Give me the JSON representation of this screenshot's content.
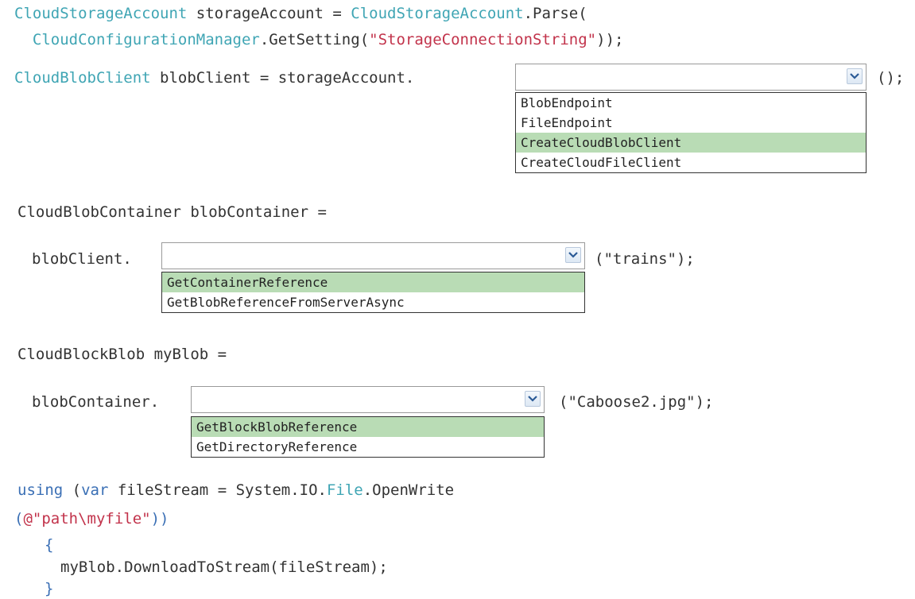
{
  "code": {
    "l1": {
      "t1": "CloudStorageAccount",
      "t2": " storageAccount = ",
      "t3": "CloudStorageAccount",
      "t4": ".Parse("
    },
    "l2": {
      "t1": "  CloudConfigurationManager",
      "t2": ".GetSetting(",
      "t3": "\"StorageConnectionString\"",
      "t4": "));"
    },
    "l3": {
      "t1": "CloudBlobClient",
      "t2": " blobClient = storageAccount.",
      "suffix": "();"
    },
    "l4": {
      "text": "CloudBlobContainer blobContainer ="
    },
    "l5": {
      "prefix": "blobClient.",
      "suffix": "(\"trains\");"
    },
    "l6": {
      "text": "CloudBlockBlob myBlob ="
    },
    "l7": {
      "prefix": "blobContainer.",
      "suffix": "(\"Caboose2.jpg\");"
    },
    "l8": {
      "t1": "using",
      "t2": " (",
      "t3": "var",
      "t4": " fileStream = System.IO.",
      "t5": "File",
      "t6": ".OpenWrite"
    },
    "l9": {
      "t1": "(",
      "t2": "@\"path\\myfile\"",
      "t3": "))"
    },
    "l10": {
      "text": "{"
    },
    "l11": {
      "text": "myBlob.DownloadToStream(fileStream);"
    },
    "l12": {
      "text": "}"
    }
  },
  "dropdown1": {
    "value": "",
    "options": [
      "BlobEndpoint",
      "FileEndpoint",
      "CreateCloudBlobClient",
      "CreateCloudFileClient"
    ],
    "highlighted": "CreateCloudBlobClient"
  },
  "dropdown2": {
    "value": "",
    "options": [
      "GetContainerReference",
      "GetBlobReferenceFromServerAsync"
    ],
    "highlighted": "GetContainerReference"
  },
  "dropdown3": {
    "value": "",
    "options": [
      "GetBlockBlobReference",
      "GetDirectoryReference"
    ],
    "highlighted": "GetBlockBlobReference"
  },
  "colors": {
    "type": "#3fa5b4",
    "string": "#c2334b",
    "keyword": "#3a6fb5",
    "highlight": "#b9dcb5"
  },
  "icons": {
    "combo_arrow": "chevron-down-icon"
  }
}
